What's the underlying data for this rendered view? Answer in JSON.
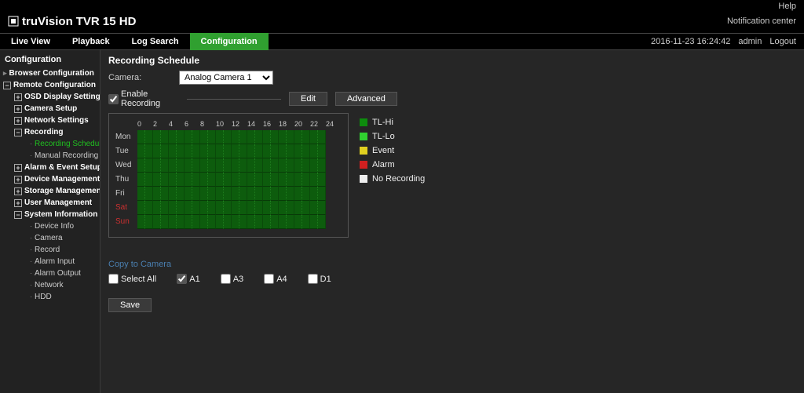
{
  "top": {
    "help": "Help",
    "notification": "Notification center"
  },
  "brand": {
    "name": "truVision",
    "model": "TVR 15 HD"
  },
  "nav": {
    "live_view": "Live View",
    "playback": "Playback",
    "log_search": "Log Search",
    "configuration": "Configuration",
    "timestamp": "2016-11-23 16:24:42",
    "user": "admin",
    "logout": "Logout"
  },
  "sidebar": {
    "title": "Configuration",
    "browser_cfg": "Browser Configuration",
    "remote_cfg": "Remote Configuration",
    "osd": "OSD Display Settings",
    "camera_setup": "Camera Setup",
    "network_settings": "Network Settings",
    "recording": "Recording",
    "recording_schedule": "Recording Schedule",
    "manual_recording": "Manual Recording",
    "alarm_event": "Alarm & Event Setup",
    "device_mgmt": "Device Management",
    "storage_mgmt": "Storage Management",
    "user_mgmt": "User Management",
    "sys_info": "System Information",
    "device_info": "Device Info",
    "camera": "Camera",
    "record": "Record",
    "alarm_input": "Alarm Input",
    "alarm_output": "Alarm Output",
    "network": "Network",
    "hdd": "HDD"
  },
  "content": {
    "title": "Recording Schedule",
    "camera_label": "Camera:",
    "camera_value": "Analog Camera 1",
    "enable_recording": "Enable Recording",
    "edit": "Edit",
    "advanced": "Advanced",
    "hours": [
      "0",
      "2",
      "4",
      "6",
      "8",
      "10",
      "12",
      "14",
      "16",
      "18",
      "20",
      "22",
      "24"
    ],
    "days": [
      "Mon",
      "Tue",
      "Wed",
      "Thu",
      "Fri",
      "Sat",
      "Sun"
    ],
    "legend": {
      "tlhi": "TL-Hi",
      "tllo": "TL-Lo",
      "event": "Event",
      "alarm": "Alarm",
      "none": "No Recording"
    },
    "copy_link": "Copy to Camera",
    "select_all": "Select All",
    "ch": {
      "a1": "A1",
      "a3": "A3",
      "a4": "A4",
      "d1": "D1"
    },
    "save": "Save"
  }
}
